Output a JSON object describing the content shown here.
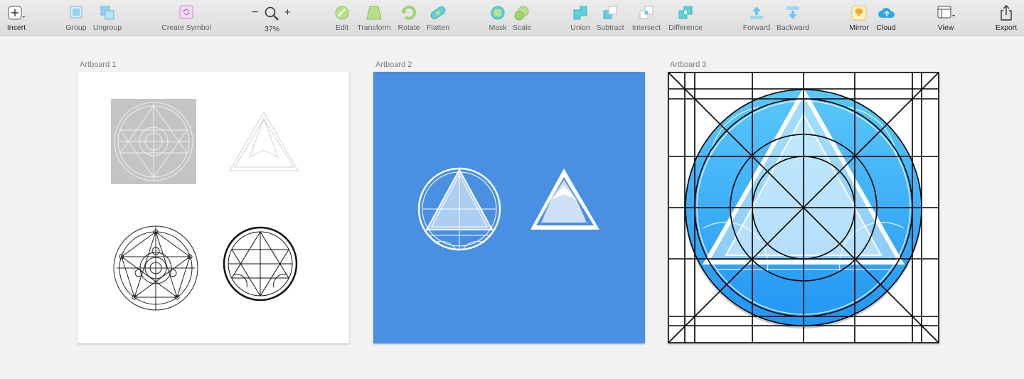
{
  "toolbar": {
    "insert": "Insert",
    "group": "Group",
    "ungroup": "Ungroup",
    "create_symbol": "Create Symbol",
    "zoom_minus": "−",
    "zoom_plus": "+",
    "zoom_level": "37%",
    "edit": "Edit",
    "transform": "Transform",
    "rotate": "Rotate",
    "flatten": "Flatten",
    "mask": "Mask",
    "scale": "Scale",
    "union": "Union",
    "subtract": "Subtract",
    "intersect": "Intersect",
    "difference": "Difference",
    "forward": "Forward",
    "backward": "Backward",
    "mirror": "Mirror",
    "cloud": "Cloud",
    "view": "View",
    "export": "Export"
  },
  "artboards": [
    {
      "name": "Artboard 1"
    },
    {
      "name": "Artboard 2",
      "background": "#4a90e2"
    },
    {
      "name": "Artboard 3"
    }
  ],
  "colors": {
    "canvas": "#f2f2f2",
    "icon_blue_top": "#5ac8fa",
    "icon_blue_bottom": "#2196f3"
  }
}
